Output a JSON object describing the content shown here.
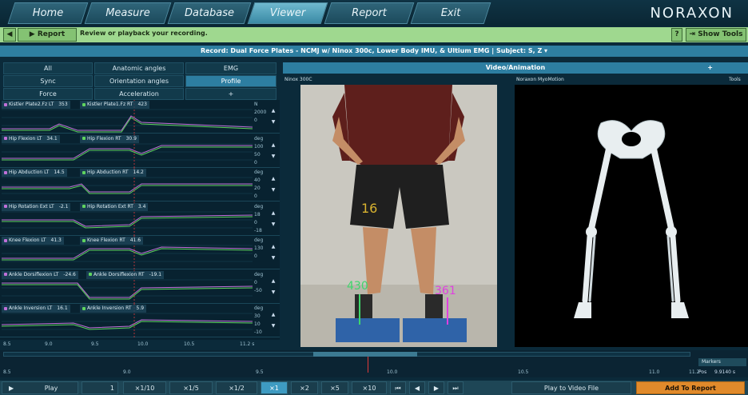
{
  "nav": {
    "tabs": [
      {
        "label": "Home",
        "icon": "home-icon"
      },
      {
        "label": "Measure",
        "icon": "measure-icon"
      },
      {
        "label": "Database",
        "icon": "database-icon"
      },
      {
        "label": "Viewer",
        "icon": "viewer-icon"
      },
      {
        "label": "Report",
        "icon": "report-icon"
      },
      {
        "label": "Exit",
        "icon": "exit-icon"
      }
    ],
    "active": "Viewer",
    "logo": "NORAXON"
  },
  "toolbar": {
    "report_label": "Report",
    "message": "Review or playback your recording.",
    "help_label": "?",
    "show_tools_label": "Show Tools"
  },
  "record_title": "Record: Dual Force Plates - NCMJ w/ Ninox 300c, Lower Body IMU, & Ultium EMG | Subject: S, Z ▾",
  "left_tabs": [
    {
      "label": "All"
    },
    {
      "label": "Anatomic angles"
    },
    {
      "label": "EMG"
    },
    {
      "label": "Sync"
    },
    {
      "label": "Orientation angles"
    },
    {
      "label": "Profile",
      "active": true
    },
    {
      "label": "Force"
    },
    {
      "label": "Acceleration"
    },
    {
      "label": "+"
    }
  ],
  "charts": [
    {
      "l1": "Kistler Plate2.Fz LT",
      "v1": "353",
      "l2": "Kistler Plate1.Fz RT",
      "v2": "423",
      "unit": "N",
      "t1": "2000",
      "t2": "0"
    },
    {
      "l1": "Hip Flexion LT",
      "v1": "34.1",
      "l2": "Hip Flexion RT",
      "v2": "30.9",
      "unit": "deg",
      "t1": "100",
      "t2": "50",
      "t3": "0"
    },
    {
      "l1": "Hip Abduction LT",
      "v1": "14.5",
      "l2": "Hip Abduction RT",
      "v2": "14.2",
      "unit": "deg",
      "t1": "40",
      "t2": "20",
      "t3": "0"
    },
    {
      "l1": "Hip Rotation Ext LT",
      "v1": "-2.1",
      "l2": "Hip Rotation Ext RT",
      "v2": "3.4",
      "unit": "deg",
      "t1": "18",
      "t2": "0",
      "t3": "-18"
    },
    {
      "l1": "Knee Flexion LT",
      "v1": "41.3",
      "l2": "Knee Flexion RT",
      "v2": "41.6",
      "unit": "deg",
      "t1": "130",
      "t2": "0"
    },
    {
      "l1": "Ankle Dorsiflexion LT",
      "v1": "-24.6",
      "l2": "Ankle Dorsiflexion RT",
      "v2": "-19.1",
      "unit": "deg",
      "t1": "0",
      "t2": "-50"
    },
    {
      "l1": "Ankle Inversion LT",
      "v1": "16.1",
      "l2": "Ankle Inversion RT",
      "v2": "5.9",
      "unit": "deg",
      "t1": "30",
      "t2": "10",
      "t3": "-10"
    }
  ],
  "chart_x_ticks": [
    "8.5",
    "9.0",
    "9.5",
    "10.0",
    "10.5",
    "11.2 s"
  ],
  "video": {
    "header": "Video/Animation",
    "left_label": "Ninox 300C",
    "right_label": "Noraxon MyoMotion",
    "tools_label": "Tools",
    "plus_label": "+",
    "force_left": "430",
    "force_right": "361",
    "shirt_number": "16"
  },
  "timeline": {
    "ticks": [
      "8.5",
      "9.0",
      "9.5",
      "10.0",
      "10.5",
      "11.0",
      "11.2"
    ],
    "markers_label": "Markers",
    "pos_label": "Pos",
    "pos_value": "9.9140 s"
  },
  "bottom": {
    "play_label": "Play",
    "frame_value": "1",
    "speeds": [
      "×1/10",
      "×1/5",
      "×1/2",
      "×1",
      "×2",
      "×5",
      "×10"
    ],
    "selected_speed": "×1",
    "play_to_video": "Play to Video File",
    "add_report": "Add To Report"
  },
  "colors": {
    "left_series": "#c070d8",
    "right_series": "#5fd35f",
    "accent": "#2d7ea1",
    "toolbar_green": "#9fd88f",
    "add_report_orange": "#e08a2b"
  }
}
